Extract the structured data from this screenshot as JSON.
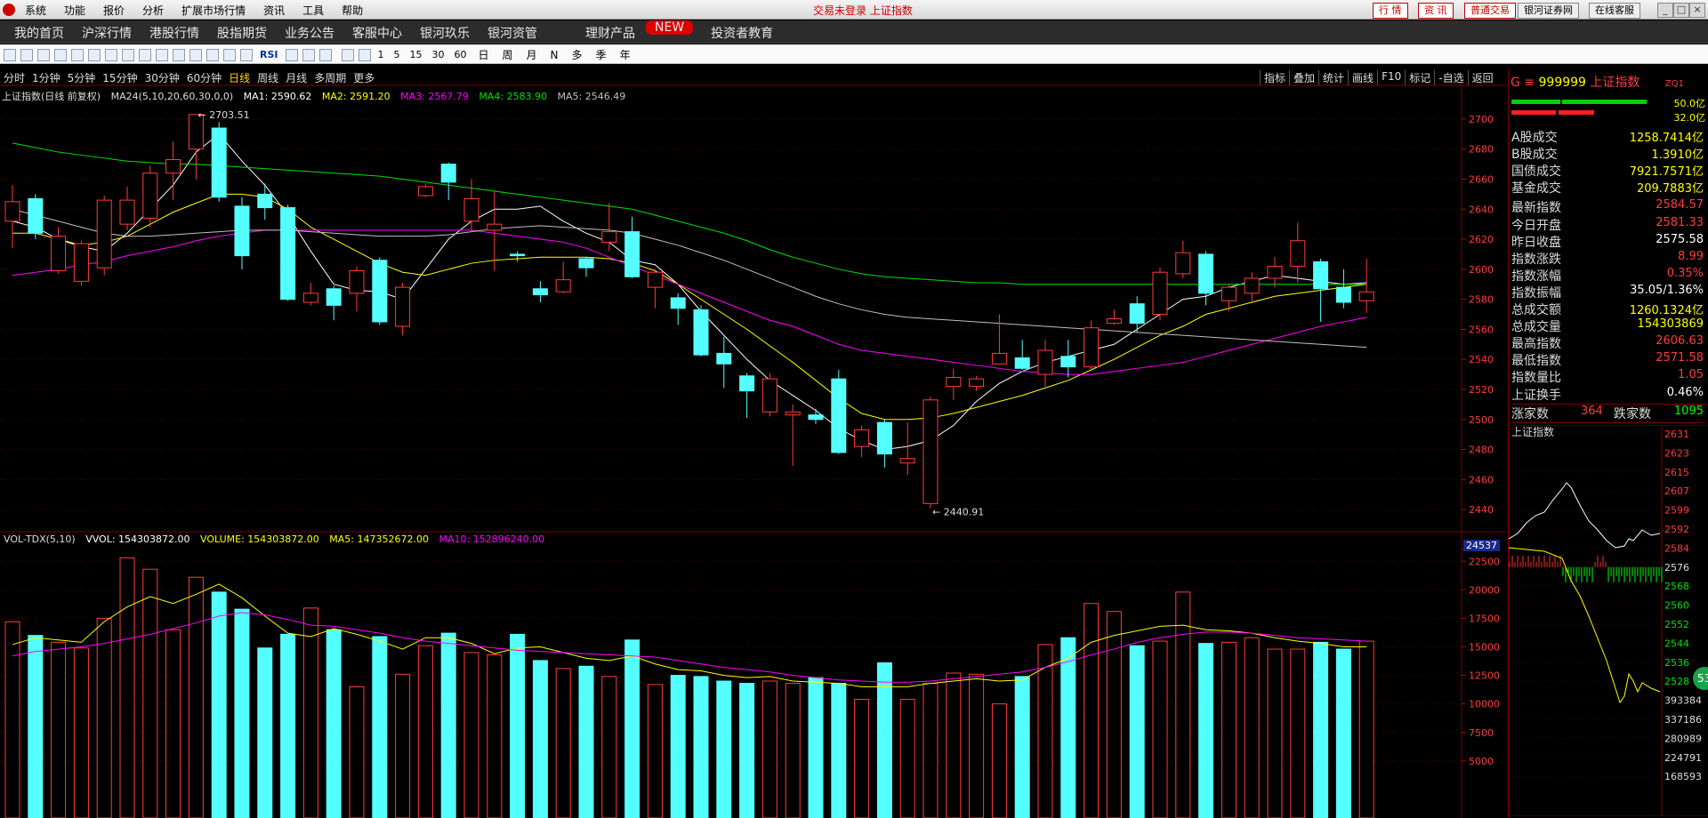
{
  "titlebar": {
    "menu": [
      "系统",
      "功能",
      "报价",
      "分析",
      "扩展市场行情",
      "资讯",
      "工具",
      "帮助"
    ],
    "center_text": "交易未登录 上证指数",
    "buttons": [
      "行 情",
      "资 讯",
      "普通交易",
      "银河证券网",
      "在线客服"
    ]
  },
  "navbar": {
    "items": [
      "我的首页",
      "沪深行情",
      "港股行情",
      "股指期货",
      "业务公告",
      "客服中心",
      "银河玖乐",
      "银河资管",
      "理财产品",
      "投资者教育"
    ],
    "new_badge": "NEW"
  },
  "toolbar": {
    "tool_labels": [
      "RSI"
    ],
    "periods": [
      "1",
      "5",
      "15",
      "30",
      "60"
    ],
    "period_names": [
      "日",
      "周",
      "月",
      "N",
      "多",
      "季",
      "年"
    ]
  },
  "periodbar": {
    "items": [
      "分时",
      "1分钟",
      "5分钟",
      "15分钟",
      "30分钟",
      "60分钟",
      "日线",
      "周线",
      "月线",
      "多周期",
      "更多"
    ],
    "active": "日线",
    "right_tools": [
      "指标",
      "叠加",
      "统计",
      "画线",
      "F10",
      "标记",
      "-自选",
      "返回"
    ]
  },
  "main_legend": {
    "title": "上证指数(日线 前复权)",
    "params": "MA24(5,10,20,60,30,0,0)",
    "ma1": "MA1: 2590.62",
    "ma2": "MA2: 2591.20",
    "ma3": "MA3: 2567.79",
    "ma4": "MA4: 2583.90",
    "ma5": "MA5: 2546.49"
  },
  "vol_legend": {
    "title": "VOL-TDX(5,10)",
    "vvol": "VVOL: 154303872.00",
    "volume": "VOLUME: 154303872.00",
    "ma5": "MA5: 147352672.00",
    "ma10": "MA10: 152896240.00",
    "cursor_value": "24537"
  },
  "annotations": {
    "high": "2703.51",
    "low": "2440.91"
  },
  "colors": {
    "up": "#ff3c3c",
    "down": "#54ffff",
    "ma1": "#ffffff",
    "ma2": "#ffff00",
    "ma3": "#ff00ff",
    "ma4": "#00e000",
    "ma5": "#c0c0c0"
  },
  "chart_data": {
    "type": "candlestick",
    "price_axis": {
      "ylim": [
        2430,
        2710
      ],
      "ticks": [
        2700,
        2680,
        2660,
        2640,
        2620,
        2600,
        2580,
        2560,
        2540,
        2520,
        2500,
        2480,
        2460,
        2440
      ]
    },
    "volume_axis": {
      "ticks": [
        22500,
        20000,
        17500,
        15000,
        12500,
        10000,
        7500,
        5000
      ]
    },
    "candles": [
      [
        2632,
        2645,
        2614,
        2656
      ],
      [
        2647,
        2624,
        2620,
        2650
      ],
      [
        2599,
        2622,
        2597,
        2628
      ],
      [
        2592,
        2617,
        2589,
        2619
      ],
      [
        2601,
        2646,
        2596,
        2649
      ],
      [
        2630,
        2646,
        2626,
        2655
      ],
      [
        2634,
        2664,
        2628,
        2669
      ],
      [
        2664,
        2673,
        2646,
        2685
      ],
      [
        2680,
        2703,
        2660,
        2703
      ],
      [
        2694,
        2648,
        2645,
        2698
      ],
      [
        2642,
        2609,
        2600,
        2648
      ],
      [
        2650,
        2641,
        2633,
        2657
      ],
      [
        2641,
        2580,
        2579,
        2643
      ],
      [
        2578,
        2584,
        2576,
        2591
      ],
      [
        2587,
        2576,
        2566,
        2589
      ],
      [
        2584,
        2599,
        2572,
        2602
      ],
      [
        2606,
        2565,
        2563,
        2608
      ],
      [
        2562,
        2588,
        2556,
        2591
      ],
      [
        2649,
        2655,
        2648,
        2657
      ],
      [
        2670,
        2658,
        2646,
        2671
      ],
      [
        2632,
        2647,
        2625,
        2660
      ],
      [
        2626,
        2630,
        2599,
        2652
      ],
      [
        2610,
        2609,
        2605,
        2612
      ],
      [
        2587,
        2583,
        2578,
        2592
      ],
      [
        2585,
        2593,
        2584,
        2605
      ],
      [
        2607,
        2601,
        2595,
        2608
      ],
      [
        2618,
        2625,
        2612,
        2644
      ],
      [
        2625,
        2595,
        2594,
        2635
      ],
      [
        2588,
        2598,
        2574,
        2600
      ],
      [
        2581,
        2574,
        2563,
        2584
      ],
      [
        2573,
        2543,
        2542,
        2576
      ],
      [
        2544,
        2537,
        2521,
        2555
      ],
      [
        2529,
        2519,
        2501,
        2531
      ],
      [
        2505,
        2527,
        2502,
        2531
      ],
      [
        2503,
        2505,
        2469,
        2510
      ],
      [
        2503,
        2500,
        2497,
        2507
      ],
      [
        2527,
        2478,
        2477,
        2533
      ],
      [
        2482,
        2493,
        2475,
        2496
      ],
      [
        2498,
        2477,
        2468,
        2500
      ],
      [
        2471,
        2474,
        2463,
        2498
      ],
      [
        2444,
        2513,
        2441,
        2515
      ],
      [
        2522,
        2528,
        2513,
        2534
      ],
      [
        2522,
        2527,
        2519,
        2529
      ],
      [
        2537,
        2544,
        2537,
        2570
      ],
      [
        2541,
        2534,
        2533,
        2553
      ],
      [
        2530,
        2546,
        2522,
        2553
      ],
      [
        2542,
        2535,
        2528,
        2553
      ],
      [
        2535,
        2561,
        2533,
        2566
      ],
      [
        2564,
        2567,
        2563,
        2573
      ],
      [
        2577,
        2564,
        2558,
        2582
      ],
      [
        2570,
        2598,
        2566,
        2601
      ],
      [
        2597,
        2611,
        2594,
        2619
      ],
      [
        2610,
        2584,
        2576,
        2612
      ],
      [
        2579,
        2588,
        2572,
        2590
      ],
      [
        2584,
        2594,
        2578,
        2598
      ],
      [
        2594,
        2602,
        2588,
        2608
      ],
      [
        2602,
        2619,
        2591,
        2631
      ],
      [
        2605,
        2587,
        2565,
        2607
      ],
      [
        2588,
        2578,
        2574,
        2600
      ],
      [
        2579,
        2585,
        2571,
        2607
      ]
    ],
    "volumes": [
      17200,
      16000,
      15400,
      14900,
      17500,
      22800,
      21800,
      16500,
      21100,
      19800,
      18300,
      14900,
      16100,
      18400,
      16500,
      11500,
      15900,
      12600,
      15100,
      16200,
      14500,
      14300,
      16100,
      13800,
      13100,
      13300,
      12400,
      15600,
      11700,
      12500,
      12400,
      12000,
      11800,
      12000,
      11800,
      12300,
      11800,
      10400,
      13600,
      10400,
      11800,
      12700,
      12600,
      10000,
      12400,
      15200,
      15800,
      18800,
      18100,
      15100,
      15500,
      19800,
      15300,
      15400,
      15800,
      14800,
      14800,
      15400,
      14800,
      15500
    ],
    "ma_lines": {
      "ma1": [
        2632,
        2628,
        2620,
        2615,
        2612,
        2624,
        2640,
        2656,
        2678,
        2690,
        2672,
        2656,
        2636,
        2612,
        2590,
        2586,
        2585,
        2580,
        2600,
        2620,
        2632,
        2640,
        2640,
        2642,
        2632,
        2624,
        2618,
        2606,
        2603,
        2590,
        2572,
        2556,
        2540,
        2526,
        2516,
        2506,
        2494,
        2486,
        2480,
        2482,
        2486,
        2496,
        2512,
        2524,
        2532,
        2538,
        2542,
        2546,
        2550,
        2560,
        2570,
        2580,
        2582,
        2588,
        2592,
        2596,
        2594,
        2592,
        2590,
        2591
      ],
      "ma2": [
        2624,
        2624,
        2620,
        2616,
        2618,
        2622,
        2630,
        2638,
        2644,
        2650,
        2650,
        2648,
        2640,
        2628,
        2620,
        2612,
        2604,
        2598,
        2596,
        2600,
        2604,
        2606,
        2607,
        2608,
        2608,
        2608,
        2607,
        2604,
        2599,
        2590,
        2580,
        2570,
        2560,
        2549,
        2538,
        2526,
        2514,
        2504,
        2500,
        2500,
        2501,
        2504,
        2508,
        2512,
        2516,
        2521,
        2526,
        2533,
        2540,
        2548,
        2556,
        2562,
        2570,
        2574,
        2578,
        2582,
        2584,
        2586,
        2588,
        2590
      ],
      "ma3": [
        2596,
        2598,
        2600,
        2603,
        2605,
        2609,
        2612,
        2615,
        2619,
        2622,
        2624,
        2626,
        2626,
        2626,
        2626,
        2626,
        2626,
        2626,
        2626,
        2626,
        2626,
        2624,
        2622,
        2620,
        2618,
        2614,
        2608,
        2602,
        2596,
        2590,
        2584,
        2578,
        2572,
        2566,
        2562,
        2556,
        2550,
        2546,
        2544,
        2542,
        2540,
        2538,
        2536,
        2534,
        2532,
        2531,
        2530,
        2530,
        2532,
        2534,
        2536,
        2538,
        2542,
        2546,
        2550,
        2554,
        2558,
        2562,
        2565,
        2568
      ],
      "ma4": [
        2684,
        2681,
        2678,
        2676,
        2674,
        2672,
        2671,
        2670,
        2670,
        2669,
        2668,
        2667,
        2666,
        2665,
        2664,
        2663,
        2662,
        2660,
        2658,
        2656,
        2654,
        2652,
        2650,
        2648,
        2646,
        2644,
        2642,
        2640,
        2636,
        2632,
        2628,
        2624,
        2619,
        2613,
        2608,
        2604,
        2600,
        2597,
        2595,
        2594,
        2593,
        2592,
        2591,
        2591,
        2590,
        2590,
        2590,
        2590,
        2590,
        2590,
        2590,
        2590,
        2590,
        2590,
        2590,
        2590,
        2590,
        2590,
        2590,
        2590
      ],
      "ma5": [
        2640,
        2636,
        2632,
        2628,
        2624,
        2622,
        2622,
        2623,
        2624,
        2625,
        2626,
        2626,
        2626,
        2625,
        2624,
        2623,
        2622,
        2622,
        2622,
        2623,
        2625,
        2627,
        2628,
        2629,
        2628,
        2627,
        2626,
        2624,
        2620,
        2616,
        2611,
        2606,
        2600,
        2594,
        2588,
        2582,
        2577,
        2573,
        2570,
        2568,
        2567,
        2566,
        2565,
        2564,
        2563,
        2562,
        2561,
        2560,
        2559,
        2558,
        2557,
        2556,
        2555,
        2554,
        2553,
        2552,
        2551,
        2550,
        2549,
        2548
      ]
    },
    "volume_ma5": [
      15200,
      15800,
      15600,
      15400,
      17200,
      18500,
      19400,
      18800,
      19600,
      20500,
      19300,
      17700,
      16200,
      15900,
      16600,
      16100,
      15500,
      14800,
      15800,
      15800,
      15300,
      14400,
      14900,
      15000,
      14500,
      14000,
      13800,
      14200,
      13500,
      13000,
      12900,
      12500,
      12300,
      12400,
      12000,
      11900,
      11800,
      11500,
      11500,
      11500,
      11800,
      12000,
      12200,
      12000,
      12100,
      13200,
      14000,
      15400,
      16000,
      16400,
      16800,
      16900,
      16500,
      16400,
      16200,
      15800,
      15500,
      15300,
      15000,
      15000
    ],
    "volume_ma10": [
      14200,
      14600,
      14800,
      15000,
      15300,
      15700,
      16100,
      16600,
      17100,
      17700,
      18000,
      17800,
      17400,
      16900,
      16800,
      16500,
      16200,
      15800,
      15500,
      15300,
      15100,
      14900,
      14700,
      14600,
      14500,
      14400,
      14300,
      14200,
      14100,
      13800,
      13500,
      13200,
      13000,
      12800,
      12500,
      12300,
      12100,
      12000,
      11900,
      11900,
      12000,
      12200,
      12400,
      12600,
      12800,
      13200,
      13700,
      14300,
      14800,
      15400,
      15800,
      16100,
      16300,
      16300,
      16200,
      16000,
      15800,
      15700,
      15600,
      15500
    ]
  },
  "right_panel": {
    "code": "999999",
    "name": "上证指数",
    "tag": "ZQ1",
    "g_label": "G",
    "volume_bar_labels": [
      "50.0亿",
      "32.0亿"
    ],
    "stats": [
      {
        "label": "A股成交",
        "value": "1258.7414亿",
        "color": "#ffff00"
      },
      {
        "label": "B股成交",
        "value": "1.3910亿",
        "color": "#ffff00"
      },
      {
        "label": "国债成交",
        "value": "7921.7571亿",
        "color": "#ffff00"
      },
      {
        "label": "基金成交",
        "value": "209.7883亿",
        "color": "#ffff00"
      },
      {
        "label": "最新指数",
        "value": "2584.57",
        "color": "#ff3c3c"
      },
      {
        "label": "今日开盘",
        "value": "2581.33",
        "color": "#ff3c3c"
      },
      {
        "label": "昨日收盘",
        "value": "2575.58",
        "color": "#ffffff"
      },
      {
        "label": "指数涨跌",
        "value": "8.99",
        "color": "#ff3c3c"
      },
      {
        "label": "指数涨幅",
        "value": "0.35%",
        "color": "#ff3c3c"
      },
      {
        "label": "指数振幅",
        "value": "35.05/1.36%",
        "color": "#ffffff"
      },
      {
        "label": "总成交额",
        "value": "1260.1324亿",
        "color": "#ffff00"
      },
      {
        "label": "总成交量",
        "value": "154303869",
        "color": "#ffff00"
      },
      {
        "label": "最高指数",
        "value": "2606.63",
        "color": "#ff3c3c"
      },
      {
        "label": "最低指数",
        "value": "2571.58",
        "color": "#ff3c3c"
      },
      {
        "label": "指数量比",
        "value": "1.05",
        "color": "#ff3c3c"
      },
      {
        "label": "上证换手",
        "value": "0.46%",
        "color": "#ffffff"
      }
    ],
    "up_label": "涨家数",
    "up_count": "364",
    "down_label": "跌家数",
    "down_count": "1095",
    "mini_title": "上证指数",
    "mini_ticks": [
      "2631",
      "2623",
      "2615",
      "2607",
      "2599",
      "2592",
      "2584",
      "2576",
      "2568",
      "2560",
      "2552",
      "2544",
      "2536",
      "2528",
      "393384",
      "337186",
      "280989",
      "224791",
      "168593"
    ],
    "badge": "53"
  }
}
